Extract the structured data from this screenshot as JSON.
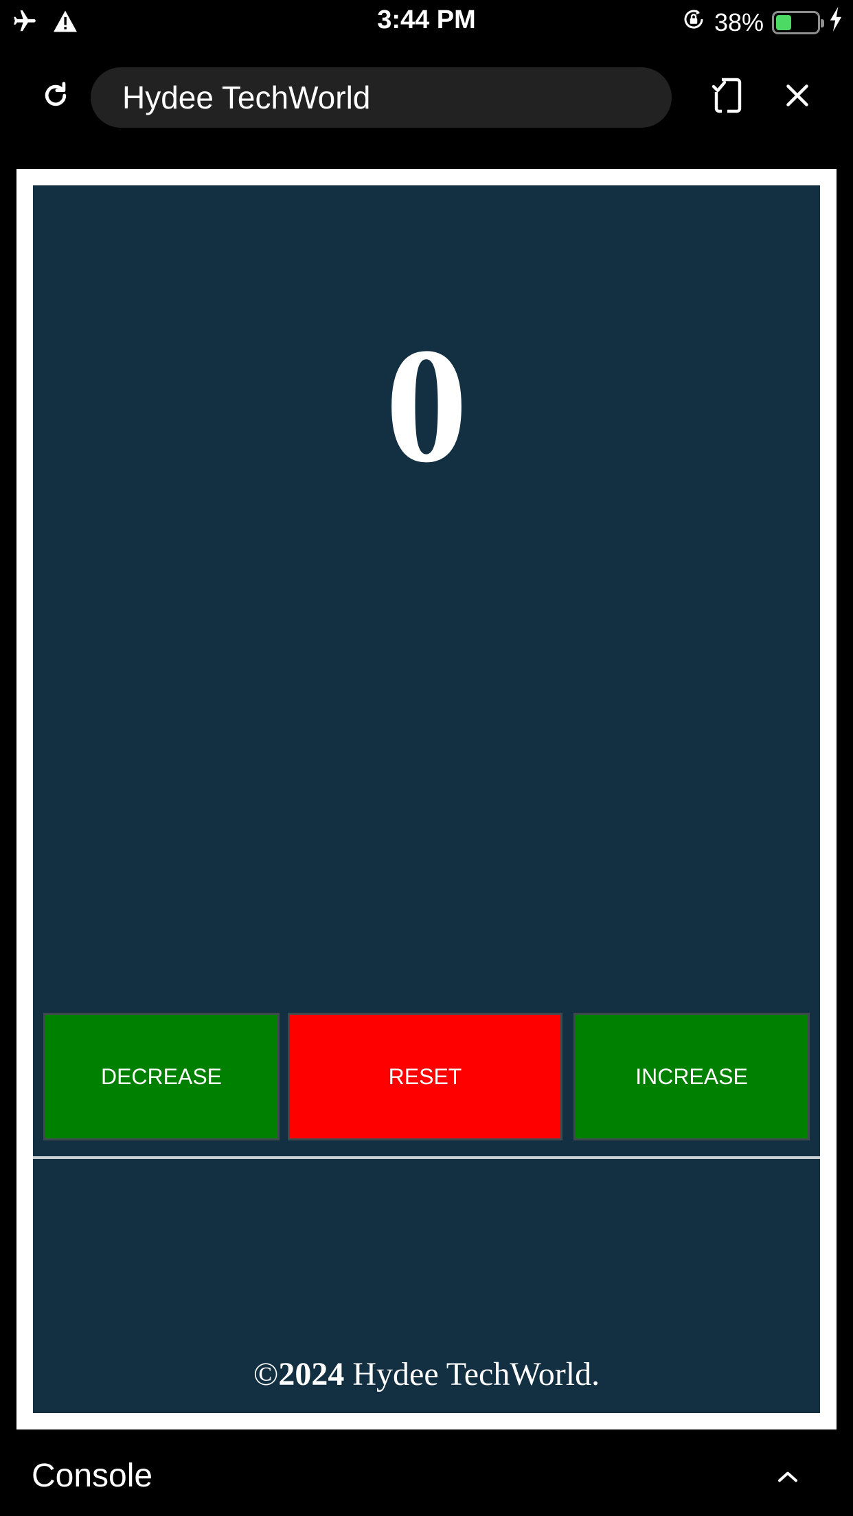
{
  "status_bar": {
    "time": "3:44 PM",
    "battery_percent": "38%",
    "battery_level": 0.38,
    "icons": [
      "airplane-icon",
      "warning-icon",
      "orientation-lock-icon",
      "battery-icon",
      "charging-bolt-icon"
    ]
  },
  "browser": {
    "title": "Hydee TechWorld",
    "icons": [
      "reload-icon",
      "device-check-icon",
      "close-icon"
    ]
  },
  "app": {
    "counter_value": "0",
    "buttons": {
      "decrease": "DECREASE",
      "reset": "RESET",
      "increase": "INCREASE"
    },
    "footer": {
      "copyright_symbol": "©",
      "year": "2024",
      "text": " Hydee TechWorld."
    },
    "colors": {
      "background": "#132f42",
      "decrease_button": "#008000",
      "reset_button": "#ff0000",
      "increase_button": "#008000"
    }
  },
  "console": {
    "label": "Console",
    "toggle_icon": "chevron-up-icon"
  }
}
